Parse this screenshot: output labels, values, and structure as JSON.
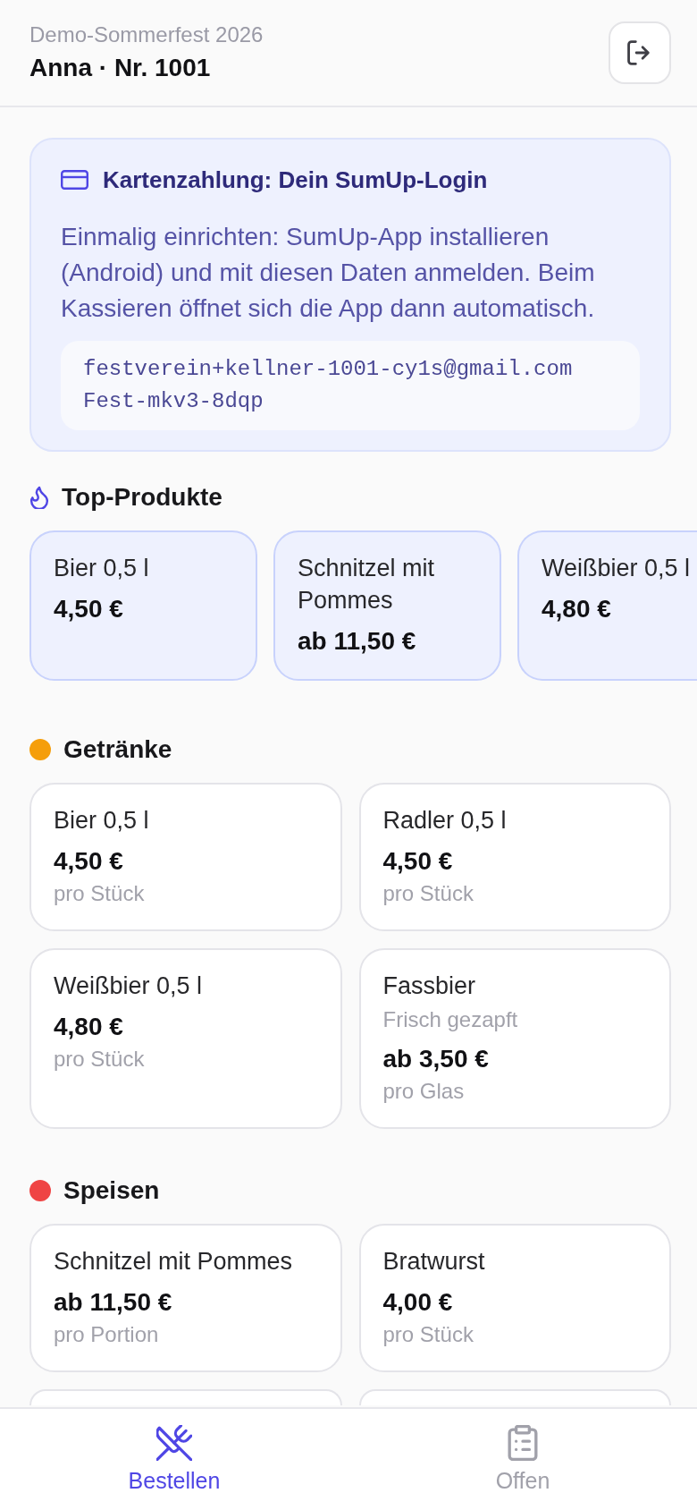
{
  "header": {
    "event": "Demo-Sommerfest 2026",
    "user": "Anna · Nr. 1001"
  },
  "payment_notice": {
    "title": "Kartenzahlung: Dein SumUp-Login",
    "text": "Einmalig einrichten: SumUp-App installieren (Android) und mit diesen Daten anmelden. Beim Kassieren öffnet sich die App dann automatisch.",
    "credentials": [
      "festverein+kellner-1001-cy1s@gmail.com",
      "Fest-mkv3-8dqp"
    ]
  },
  "top_products": {
    "title": "Top-Produkte",
    "items": [
      {
        "name": "Bier 0,5 l",
        "price": "4,50 €"
      },
      {
        "name": "Schnitzel mit Pommes",
        "price": "ab 11,50 €"
      },
      {
        "name": "Weißbier 0,5 l",
        "price": "4,80 €"
      }
    ]
  },
  "categories": [
    {
      "name": "Getränke",
      "color": "#f59e0b",
      "items": [
        {
          "name": "Bier 0,5 l",
          "price": "4,50 €",
          "unit": "pro Stück"
        },
        {
          "name": "Radler 0,5 l",
          "price": "4,50 €",
          "unit": "pro Stück"
        },
        {
          "name": "Weißbier 0,5 l",
          "price": "4,80 €",
          "unit": "pro Stück"
        },
        {
          "name": "Fassbier",
          "description": "Frisch gezapft",
          "price": "ab 3,50 €",
          "unit": "pro Glas"
        }
      ]
    },
    {
      "name": "Speisen",
      "color": "#ef4444",
      "items": [
        {
          "name": "Schnitzel mit Pommes",
          "price": "ab 11,50 €",
          "unit": "pro Portion"
        },
        {
          "name": "Bratwurst",
          "price": "4,00 €",
          "unit": "pro Stück"
        }
      ]
    }
  ],
  "bottom_nav": [
    {
      "label": "Bestellen",
      "selected": true
    },
    {
      "label": "Offen",
      "selected": false
    }
  ]
}
